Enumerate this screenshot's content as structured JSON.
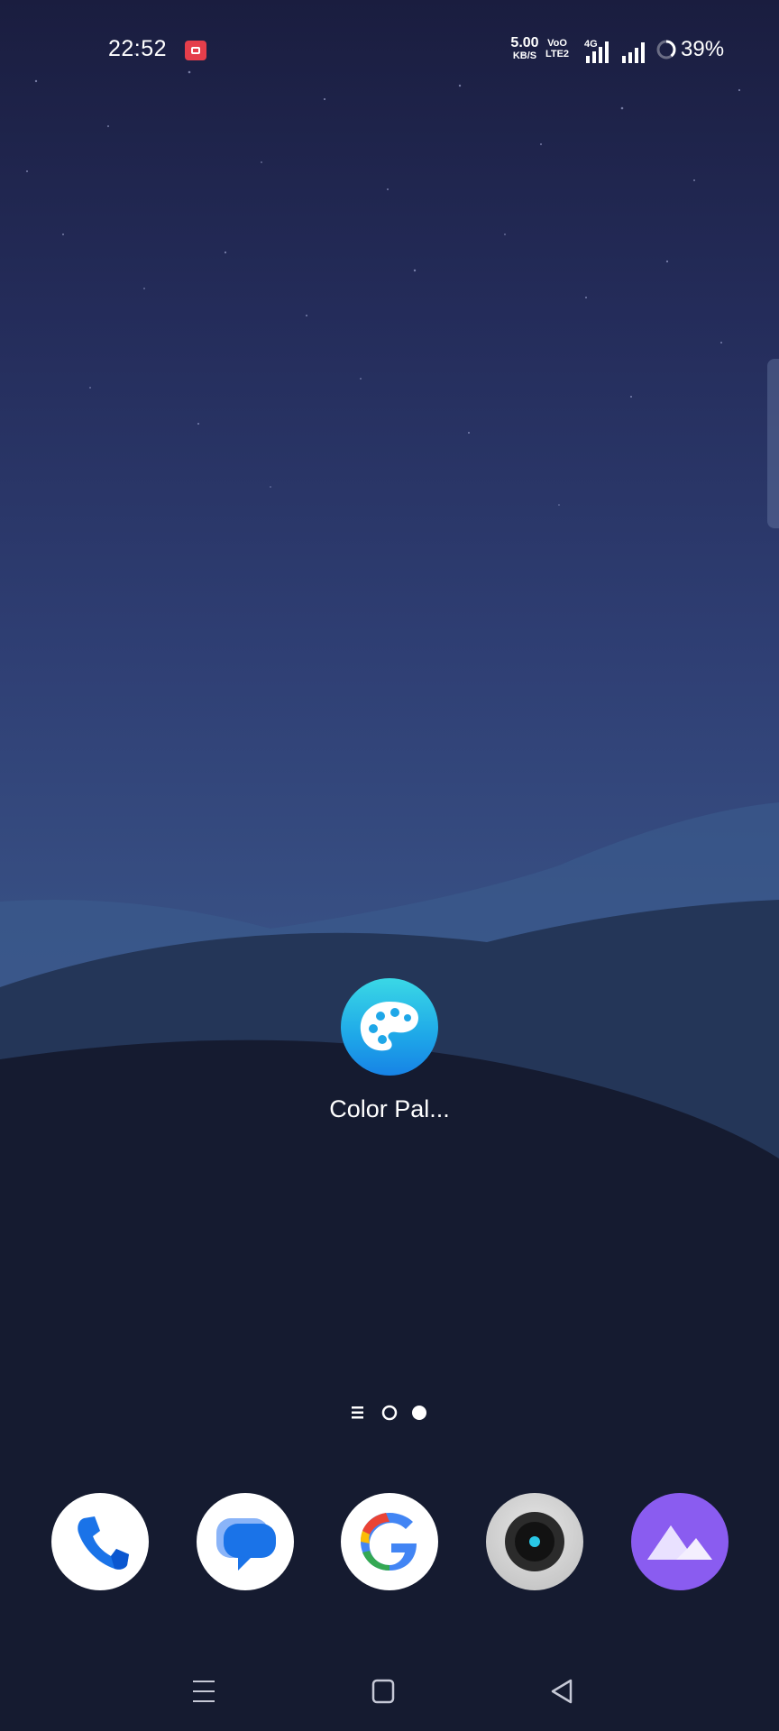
{
  "status_bar": {
    "time": "22:52",
    "net_speed_value": "5.00",
    "net_speed_unit": "KB/S",
    "volte_top": "VoO",
    "volte_bottom": "LTE2",
    "network_type": "4G",
    "battery_percent": "39%",
    "battery_level": 0.39,
    "record_color": "#e53e4b"
  },
  "home": {
    "app": {
      "label": "Color Pal...",
      "icon": "palette-icon"
    }
  },
  "page_indicator": {
    "pages": [
      "list",
      "page-1",
      "page-2"
    ],
    "current_index": 2
  },
  "dock": {
    "apps": [
      {
        "name": "phone",
        "icon": "phone-icon"
      },
      {
        "name": "messages",
        "icon": "messages-icon"
      },
      {
        "name": "google",
        "icon": "google-icon"
      },
      {
        "name": "camera",
        "icon": "camera-icon"
      },
      {
        "name": "gallery",
        "icon": "gallery-icon"
      }
    ]
  },
  "nav_bar": {
    "buttons": [
      "menu-icon",
      "home-icon",
      "back-icon"
    ]
  },
  "colors": {
    "sky_top": "#1a1d3f",
    "sky_mid": "#3a5488",
    "hill_dark": "#151a30",
    "app_icon": "#1ea7e8",
    "gallery": "#8a5cf0"
  }
}
